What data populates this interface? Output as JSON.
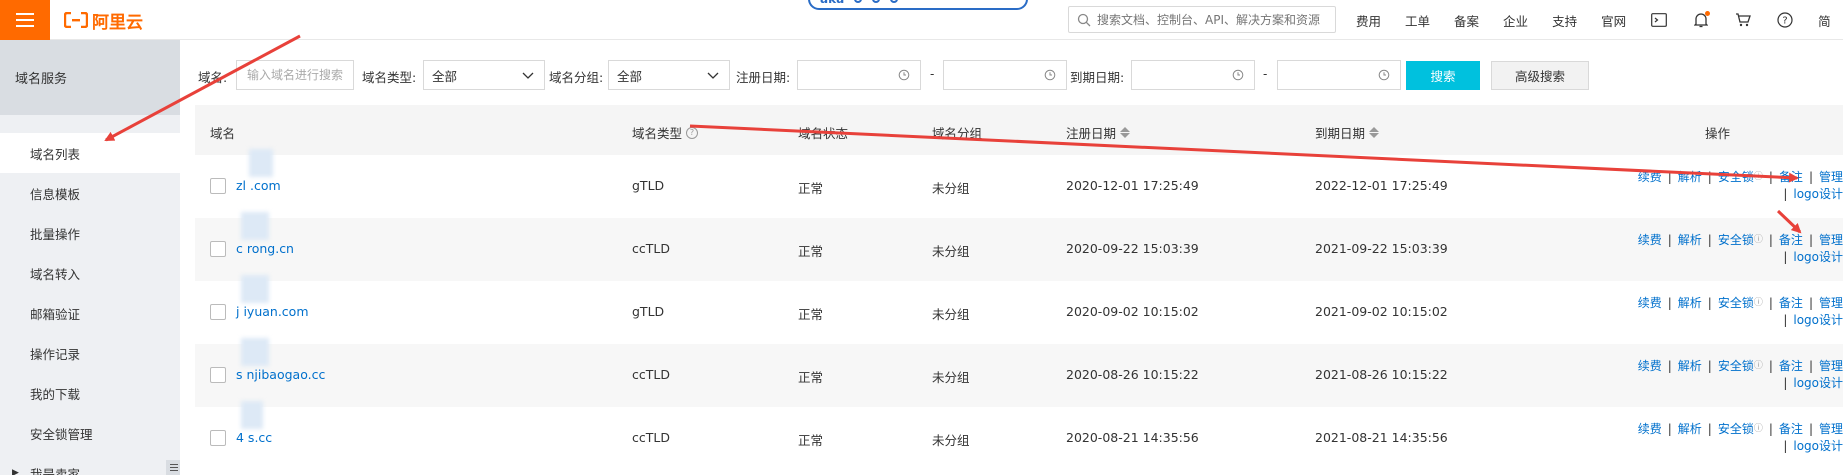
{
  "brand": {
    "name": "阿里云",
    "color": "#ff6a00"
  },
  "top_mid": {
    "badge": "aka"
  },
  "search": {
    "placeholder": "搜索文档、控制台、API、解决方案和资源"
  },
  "topnav": {
    "links": [
      "费用",
      "工单",
      "备案",
      "企业",
      "支持",
      "官网"
    ],
    "icons": [
      "terminal-icon",
      "bell-icon",
      "cart-icon",
      "help-icon"
    ],
    "last": "简"
  },
  "sidebar": {
    "title": "域名服务",
    "items": [
      {
        "label": "域名列表",
        "active": true
      },
      {
        "label": "信息模板"
      },
      {
        "label": "批量操作"
      },
      {
        "label": "域名转入"
      },
      {
        "label": "邮箱验证"
      },
      {
        "label": "操作记录"
      },
      {
        "label": "我的下载"
      },
      {
        "label": "安全锁管理"
      },
      {
        "label": "我是卖家",
        "expandable": true
      }
    ]
  },
  "filters": {
    "domain_label": "域名:",
    "domain_placeholder": "输入域名进行搜索",
    "type_label": "域名类型:",
    "type_value": "全部",
    "group_label": "域名分组:",
    "group_value": "全部",
    "reg_label": "注册日期:",
    "exp_label": "到期日期:",
    "dash": "-",
    "search_btn": "搜索",
    "advanced_btn": "高级搜索"
  },
  "table": {
    "headers": {
      "domain": "域名",
      "type": "域名类型",
      "status": "域名状态",
      "group": "域名分组",
      "reg_date": "注册日期",
      "exp_date": "到期日期",
      "ops": "操作"
    },
    "ops_labels": {
      "renew": "续费",
      "resolve": "解析",
      "lock": "安全锁",
      "note": "备注",
      "manage": "管理",
      "logo": "logo设计",
      "sep": "|"
    },
    "rows": [
      {
        "domain": "zl      .com",
        "type": "gTLD",
        "status": "正常",
        "group": "未分组",
        "reg": "2020-12-01 17:25:49",
        "exp": "2022-12-01 17:25:49"
      },
      {
        "domain": "c      rong.cn",
        "type": "ccTLD",
        "status": "正常",
        "group": "未分组",
        "reg": "2020-09-22 15:03:39",
        "exp": "2021-09-22 15:03:39"
      },
      {
        "domain": "j      iyuan.com",
        "type": "gTLD",
        "status": "正常",
        "group": "未分组",
        "reg": "2020-09-02 10:15:02",
        "exp": "2021-09-02 10:15:02"
      },
      {
        "domain": "s      njibaogao.cc",
        "type": "ccTLD",
        "status": "正常",
        "group": "未分组",
        "reg": "2020-08-26 10:15:22",
        "exp": "2021-08-26 10:15:22"
      },
      {
        "domain": "4      s.cc",
        "type": "ccTLD",
        "status": "正常",
        "group": "未分组",
        "reg": "2020-08-21 14:35:56",
        "exp": "2021-08-21 14:35:56"
      }
    ]
  },
  "annotation": {
    "arrow_color": "#e8413a"
  }
}
